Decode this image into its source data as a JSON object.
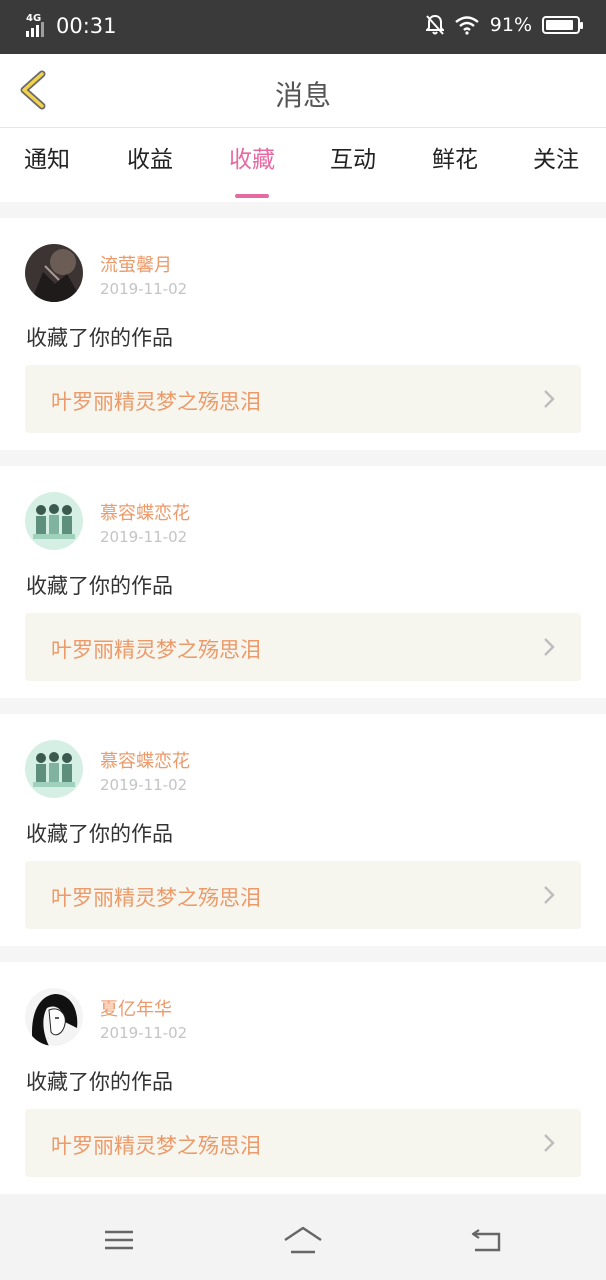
{
  "status_bar": {
    "network": "4G",
    "time": "00:31",
    "battery": "91%",
    "battery_level": 0.91,
    "icons": [
      "signal-icon",
      "mute-bell-icon",
      "wifi-icon",
      "battery-icon"
    ]
  },
  "header": {
    "title": "消息",
    "back_icon": "back-chevron-icon"
  },
  "tabs": [
    {
      "label": "通知",
      "active": false
    },
    {
      "label": "收益",
      "active": false
    },
    {
      "label": "收藏",
      "active": true
    },
    {
      "label": "互动",
      "active": false
    },
    {
      "label": "鲜花",
      "active": false
    },
    {
      "label": "关注",
      "active": false
    }
  ],
  "notifications": [
    {
      "user": "流萤馨月",
      "date": "2019-11-02",
      "action": "收藏了你的作品",
      "work": "叶罗丽精灵梦之殇思泪"
    },
    {
      "user": "慕容蝶恋花",
      "date": "2019-11-02",
      "action": "收藏了你的作品",
      "work": "叶罗丽精灵梦之殇思泪"
    },
    {
      "user": "慕容蝶恋花",
      "date": "2019-11-02",
      "action": "收藏了你的作品",
      "work": "叶罗丽精灵梦之殇思泪"
    },
    {
      "user": "夏亿年华",
      "date": "2019-11-02",
      "action": "收藏了你的作品",
      "work": "叶罗丽精灵梦之殇思泪"
    }
  ],
  "bottom_nav": {
    "icons": [
      "menu-icon",
      "home-icon",
      "back-icon"
    ]
  },
  "colors": {
    "accent": "#e66aa1",
    "username": "#ec9a6a",
    "work_bg": "#f6f6ee"
  }
}
